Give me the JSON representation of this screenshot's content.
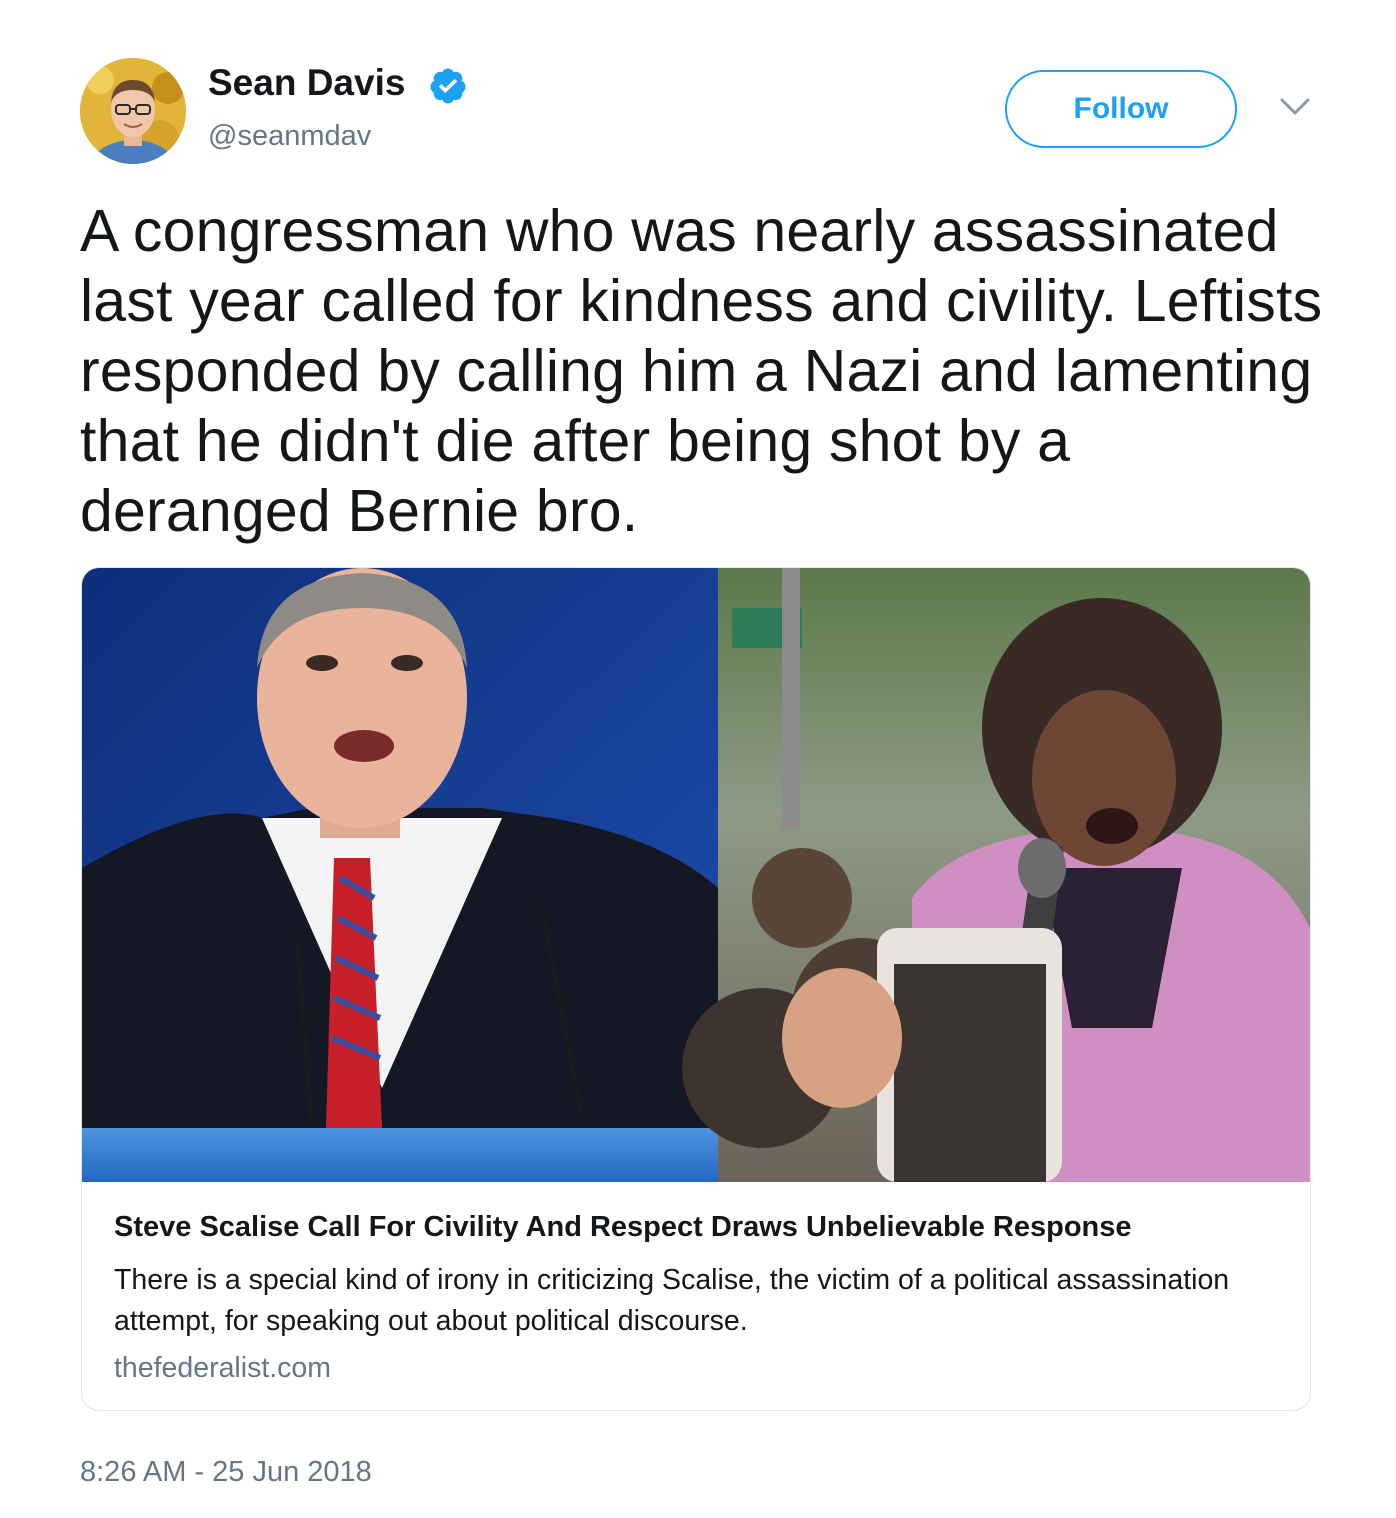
{
  "author": {
    "display_name": "Sean Davis",
    "handle": "@seanmdav",
    "verified": true,
    "avatar_icon": "profile-photo"
  },
  "actions": {
    "follow_label": "Follow",
    "menu_icon": "chevron-down-icon"
  },
  "tweet": {
    "text": "A congressman who was nearly assassinated last year called for kindness and civility. Leftists responded by calling him a Nazi and lamenting that he didn't die after being shot by a deranged Bernie bro.",
    "timestamp": "8:26 AM - 25 Jun 2018"
  },
  "card": {
    "title": "Steve Scalise Call For Civility And Respect Draws Unbelievable Response",
    "description": "There is a special kind of irony in criticizing Scalise, the victim of a political assassination attempt, for speaking out about political discourse.",
    "domain": "thefederalist.com"
  },
  "colors": {
    "accent": "#1da1f2",
    "text": "#14171a",
    "secondary_text": "#657786",
    "border": "#e1e8ed"
  }
}
